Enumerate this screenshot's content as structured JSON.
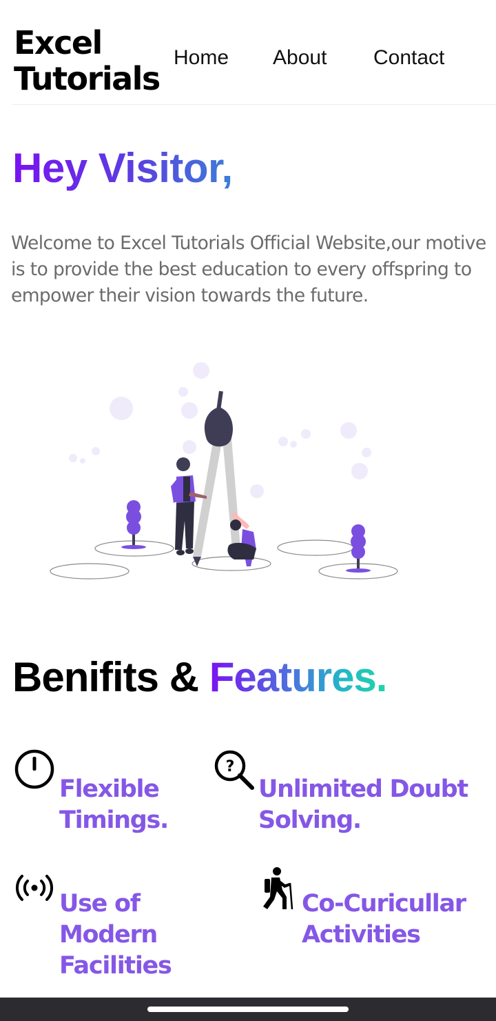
{
  "header": {
    "brand_line1": "Excel",
    "brand_line2": "Tutorials",
    "nav": {
      "home": "Home",
      "about": "About",
      "contact": "Contact"
    }
  },
  "hero": {
    "title": "Hey Visitor,",
    "text": "Welcome to Excel Tutorials Official Website,our motive is to provide the best education to every offspring to empower their vision towards the future."
  },
  "features_section": {
    "title_plain": "Benifits & ",
    "title_gradient": "Features.",
    "items": [
      {
        "label": "Flexible\nTimings.",
        "icon": "clock-icon"
      },
      {
        "label": "Unlimited Doubt\nSolving.",
        "icon": "question-search-icon"
      },
      {
        "label": "Use of Modern\nFacilities",
        "icon": "broadcast-icon"
      },
      {
        "label": "Co-Curicullar\nActivities",
        "icon": "hiking-person-icon"
      }
    ]
  },
  "colors": {
    "accent_purple": "#8557e6",
    "gradient_start": "#7a12f0",
    "gradient_end": "#20d6a6",
    "illustration_purple": "#7a4fe0",
    "bubble": "#efebfb"
  }
}
